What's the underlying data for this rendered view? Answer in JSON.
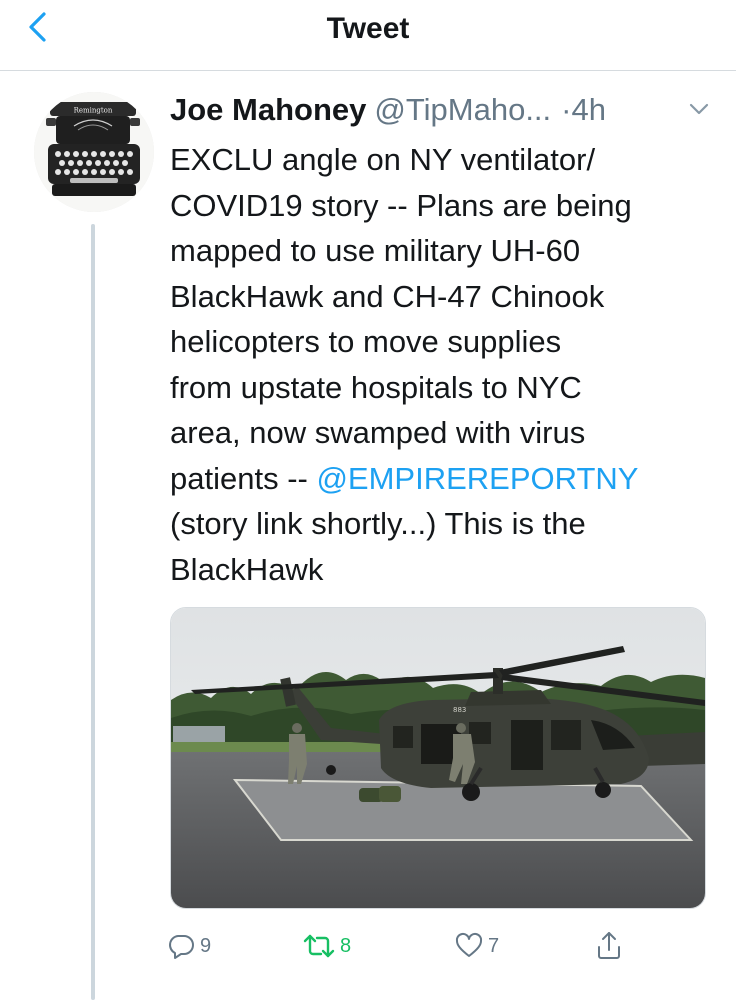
{
  "header": {
    "title": "Tweet"
  },
  "tweet": {
    "display_name": "Joe Mahoney",
    "handle": "@TipMaho...",
    "dot": "·",
    "time": "4h",
    "text_before_mention": "EXCLU angle on NY ventilator/\nCOVID19 story -- Plans are being\nmapped to use military UH-60\nBlackHawk and CH-47 Chinook\nhelicopters to move supplies\nfrom upstate hospitals to NYC\narea, now swamped with virus\npatients -- ",
    "mention": "@EMPIREREPORTNY",
    "text_after_mention": "\n(story link shortly...) This is the\nBlackHawk",
    "media_fuselage_text": "883",
    "avatar_brand": "Remington"
  },
  "actions": {
    "reply_count": "9",
    "retweet_count": "8",
    "like_count": "7"
  },
  "colors": {
    "accent": "#1da1f2",
    "retweet": "#17bf63",
    "muted": "#657786"
  },
  "icons": [
    "back-arrow-icon",
    "chevron-down-icon",
    "reply-icon",
    "retweet-icon",
    "like-icon",
    "share-icon"
  ]
}
